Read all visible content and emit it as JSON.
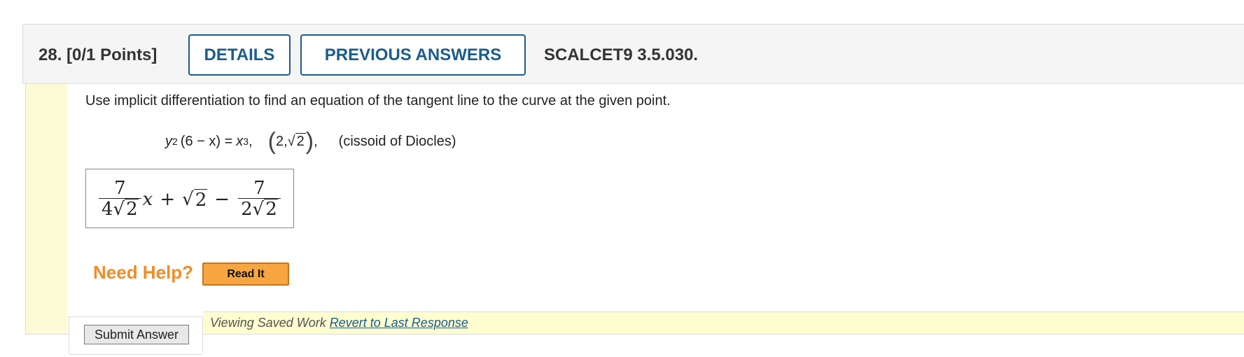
{
  "question": {
    "number_label": "28.",
    "points_label": "[0/1 Points]",
    "details_label": "DETAILS",
    "previous_answers_label": "PREVIOUS ANSWERS",
    "assignment_code": "SCALCET9 3.5.030."
  },
  "prompt": "Use implicit differentiation to find an equation of the tangent line to the curve at the given point.",
  "equation": {
    "y": "y",
    "y_exp": "2",
    "factor": "(6 − x) = ",
    "x": "x",
    "x_exp": "3",
    "comma": ",",
    "point_x": "2, ",
    "root_sign": "√",
    "root_val": "2",
    "point_comma": ",",
    "note": "(cissoid of Diocles)"
  },
  "answer": {
    "term1_num": "7",
    "term1_den_coef": "4",
    "term1_root": "√",
    "term1_rad": "2",
    "x": "x",
    "plus": "+",
    "root": "√",
    "root_val": "2",
    "minus": "−",
    "term3_num": "7",
    "term3_den_coef": "2",
    "term3_root": "√",
    "term3_rad": "2"
  },
  "help": {
    "label": "Need Help?",
    "read_it": "Read It"
  },
  "footer": {
    "viewing_text": "Viewing Saved Work ",
    "revert_link": "Revert to Last Response",
    "submit_label": "Submit Answer"
  },
  "colors": {
    "accent": "#1a5c8e",
    "help_orange": "#f08c28",
    "read_it_bg": "#f7a541",
    "saved_bar_bg": "#fdfdcf",
    "left_strip_bg": "#fcfbd5"
  }
}
